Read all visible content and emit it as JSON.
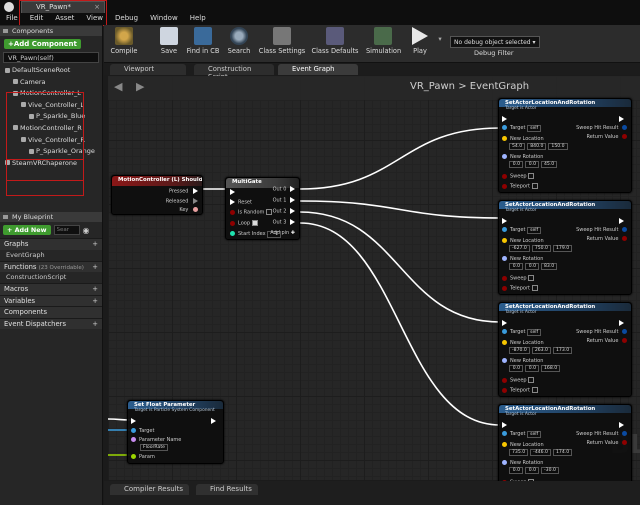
{
  "window": {
    "tab_title": "VR_Pawn*",
    "menu": [
      "File",
      "Edit",
      "Asset",
      "View",
      "Debug",
      "Window",
      "Help"
    ]
  },
  "components_panel": {
    "tab": "Components",
    "add_button": "+Add Component",
    "search_value": "VR_Pawn(self)",
    "tree": [
      {
        "label": "DefaultSceneRoot",
        "indent": 0
      },
      {
        "label": "Camera",
        "indent": 1
      },
      {
        "label": "MotionController_L",
        "indent": 1
      },
      {
        "label": "Vive_Controller_L",
        "indent": 2
      },
      {
        "label": "P_Sparkle_Blue",
        "indent": 3
      },
      {
        "label": "MotionController_R",
        "indent": 1
      },
      {
        "label": "Vive_Controller_R",
        "indent": 2
      },
      {
        "label": "P_Sparkle_Orange",
        "indent": 3
      },
      {
        "label": "SteamVRChaperone",
        "indent": 0
      }
    ]
  },
  "blueprint_panel": {
    "tab": "My Blueprint",
    "add_new": "+ Add New",
    "search_placeholder": "Sear",
    "sections": {
      "graphs": "Graphs",
      "event_graph": "EventGraph",
      "functions": "Functions",
      "functions_count": "(23 Overridable)",
      "construction_script": "ConstructionScript",
      "macros": "Macros",
      "variables": "Variables",
      "components": "Components",
      "event_dispatchers": "Event Dispatchers"
    }
  },
  "toolbar": {
    "compile": "Compile",
    "save": "Save",
    "find_in_cb": "Find in CB",
    "search": "Search",
    "class_settings": "Class Settings",
    "class_defaults": "Class Defaults",
    "simulation": "Simulation",
    "play": "Play",
    "debug_select": "No debug object selected",
    "debug_filter": "Debug Filter"
  },
  "editor_tabs": [
    "Viewport",
    "Construction Script",
    "Event Graph"
  ],
  "graph": {
    "breadcrumb_root": "VR_Pawn",
    "breadcrumb_sep": ">",
    "breadcrumb_graph": "EventGraph",
    "watermark": "BL"
  },
  "nodes": {
    "input": {
      "title": "MotionController (L) Shoulder",
      "pins": [
        "Pressed",
        "Released",
        "Key"
      ]
    },
    "multigate": {
      "title": "MultiGate",
      "inputs": [
        "Reset",
        "Is Random",
        "Loop",
        "Start Index"
      ],
      "start_index": "-1",
      "outputs": [
        "Out 0",
        "Out 1",
        "Out 2",
        "Out 3",
        "Add pin"
      ]
    },
    "set_actor": [
      {
        "title": "SetActorLocationAndRotation",
        "subtitle": "Target is Actor",
        "loc": [
          "54.0",
          "840.0",
          "150.0"
        ],
        "rot": [
          "0.0",
          "0.0",
          "45.0"
        ],
        "hit_label": "Sweep Hit Result"
      },
      {
        "title": "SetActorLocationAndRotation",
        "subtitle": "Target is Actor",
        "loc": [
          "-627.0",
          "750.0",
          "179.0"
        ],
        "rot": [
          "0.0",
          "0.0",
          "83.0"
        ],
        "hit_label": "Sweep Hit Result"
      },
      {
        "title": "SetActorLocationAndRotation",
        "subtitle": "Target is Actor",
        "loc": [
          "-870.0",
          "263.0",
          "173.0"
        ],
        "rot": [
          "0.0",
          "0.0",
          "168.0"
        ],
        "hit_label": "Sweep Hit Result"
      },
      {
        "title": "SetActorLocationAndRotation",
        "subtitle": "Target is Actor",
        "loc": [
          "735.0",
          "-446.0",
          "174.0"
        ],
        "rot": [
          "0.0",
          "0.0",
          "-30.0"
        ],
        "hit_label": "Sweep Hit Result"
      }
    ],
    "set_actor_pins": {
      "target": "Target",
      "target_value": "self",
      "new_location": "New Location",
      "new_rotation": "New Rotation",
      "sweep": "Sweep",
      "teleport": "Teleport",
      "return_value": "Return Value"
    },
    "set_float": {
      "title": "Set Float Parameter",
      "subtitle": "Target is Particle System Component",
      "pins": [
        "Target",
        "Parameter Name",
        "Param"
      ],
      "param_value": "FloorRate"
    }
  },
  "bottom_tabs": [
    "Compiler Results",
    "Find Results"
  ],
  "colors": {
    "exec": "#ffffff",
    "vector": "#f7c600",
    "rotator": "#9fb4ff",
    "object": "#3a9bdc",
    "bool": "#8e0000",
    "int": "#1fe3af",
    "highlight": "#c21a1a",
    "add_green": "#3f9b2f"
  }
}
